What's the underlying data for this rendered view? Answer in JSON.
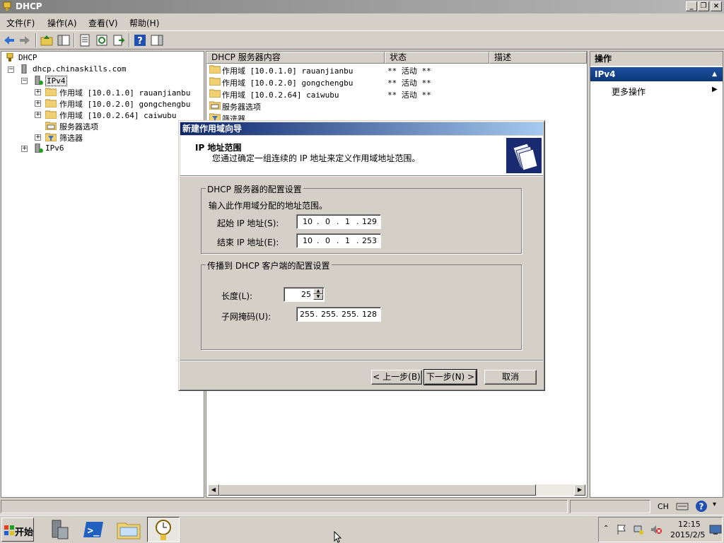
{
  "window": {
    "title": "DHCP"
  },
  "menu": {
    "file": "文件(F)",
    "action": "操作(A)",
    "view": "查看(V)",
    "help": "帮助(H)"
  },
  "tree": {
    "root": "DHCP",
    "server": "dhcp.chinaskills.com",
    "ipv4": "IPv4",
    "scope1": "作用域 [10.0.1.0] rauanjianbu",
    "scope2": "作用域 [10.0.2.0] gongchengbu",
    "scope3": "作用域 [10.0.2.64] caiwubu",
    "server_options": "服务器选项",
    "filters": "筛选器",
    "ipv6": "IPv6"
  },
  "list": {
    "headers": [
      "DHCP 服务器内容",
      "状态",
      "描述"
    ],
    "rows": [
      {
        "name": "作用域 [10.0.1.0] rauanjianbu",
        "status": "** 活动 **"
      },
      {
        "name": "作用域 [10.0.2.0] gongchengbu",
        "status": "** 活动 **"
      },
      {
        "name": "作用域 [10.0.2.64] caiwubu",
        "status": "** 活动 **"
      },
      {
        "name": "服务器选项",
        "status": ""
      },
      {
        "name": "筛选器",
        "status": ""
      }
    ]
  },
  "actions": {
    "header": "操作",
    "group": "IPv4",
    "more": "更多操作"
  },
  "dialog": {
    "title": "新建作用域向导",
    "heading": "IP 地址范围",
    "description": "您通过确定一组连续的 IP 地址来定义作用域地址范围。",
    "server_group": "DHCP 服务器的配置设置",
    "range_prompt": "输入此作用域分配的地址范围。",
    "start_label": "起始 IP 地址(S):",
    "start_ip": [
      "10",
      "0",
      "1",
      "129"
    ],
    "end_label": "结束 IP 地址(E):",
    "end_ip": [
      "10",
      "0",
      "1",
      "253"
    ],
    "client_group": "传播到 DHCP 客户端的配置设置",
    "length_label": "长度(L):",
    "length_value": "25",
    "mask_label": "子网掩码(U):",
    "mask": [
      "255",
      "255",
      "255",
      "128"
    ],
    "back_button": "< 上一步(B)",
    "next_button": "下一步(N) >",
    "cancel_button": "取消"
  },
  "statusbar": {
    "lang": "CH"
  },
  "taskbar": {
    "start": "开始",
    "time": "12:15",
    "date": "2015/2/5"
  },
  "colors": {
    "dialog_title_start": "#0a246a",
    "action_group": "#2050a0"
  }
}
